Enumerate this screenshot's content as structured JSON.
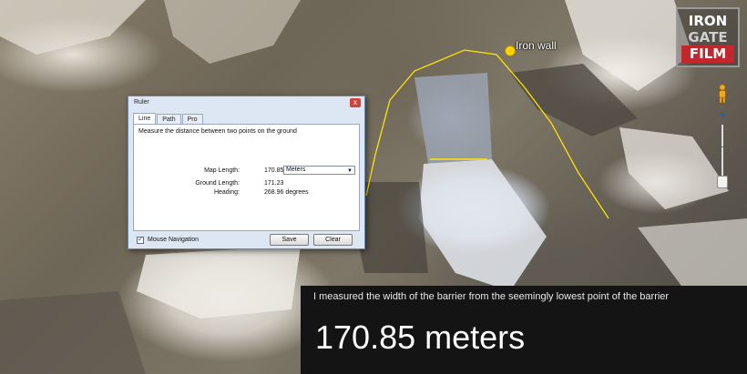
{
  "map": {
    "placemark_label": "Iron wall",
    "zoom_in_label": "+",
    "zoom_out_label": "−"
  },
  "logo": {
    "line1": "IRON",
    "line2": "GATE",
    "line3": "FILM",
    "accent_color": "#c0282d"
  },
  "ruler": {
    "title": "Ruler",
    "close_label": "x",
    "tabs": [
      {
        "label": "Line"
      },
      {
        "label": "Path"
      },
      {
        "label": "Pro"
      }
    ],
    "description": "Measure the distance between two points on the ground",
    "map_length_label": "Map Length:",
    "map_length_value": "170.85",
    "unit_selected": "Meters",
    "ground_length_label": "Ground Length:",
    "ground_length_value": "171.23",
    "heading_label": "Heading:",
    "heading_value": "268.96 degrees",
    "mouse_navigation_label": "Mouse Navigation",
    "mouse_navigation_checked": true,
    "save_label": "Save",
    "clear_label": "Clear"
  },
  "caption": {
    "small_text": "I measured the width of the barrier from the seemingly lowest point of the barrier",
    "big_text": "170.85 meters"
  },
  "colors": {
    "measure_line": "#ffe500",
    "caption_background": "#141414"
  }
}
